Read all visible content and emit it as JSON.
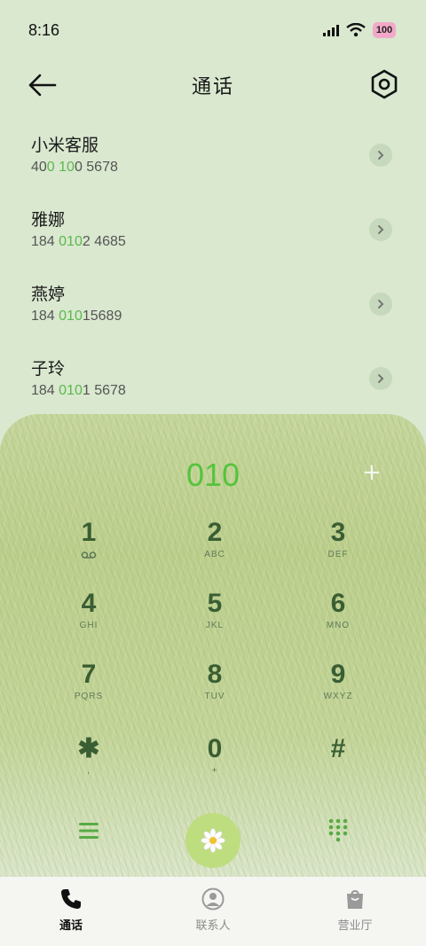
{
  "status_bar": {
    "time": "8:16",
    "battery": "100"
  },
  "header": {
    "title": "通话"
  },
  "contacts": [
    {
      "name": "小米客服",
      "number_parts": [
        "40",
        "0 10",
        "0 5678"
      ]
    },
    {
      "name": "雅娜",
      "number_parts": [
        "184 ",
        "010",
        "2 4685"
      ]
    },
    {
      "name": "燕婷",
      "number_parts": [
        "184 ",
        "010",
        "15689"
      ]
    },
    {
      "name": "子玲",
      "number_parts": [
        "184 ",
        "010",
        "1 5678"
      ]
    }
  ],
  "dialpad": {
    "dialed": "010",
    "add_symbol": "+",
    "keys": [
      {
        "digit": "1",
        "letters": ""
      },
      {
        "digit": "2",
        "letters": "ABC"
      },
      {
        "digit": "3",
        "letters": "DEF"
      },
      {
        "digit": "4",
        "letters": "GHI"
      },
      {
        "digit": "5",
        "letters": "JKL"
      },
      {
        "digit": "6",
        "letters": "MNO"
      },
      {
        "digit": "7",
        "letters": "PQRS"
      },
      {
        "digit": "8",
        "letters": "TUV"
      },
      {
        "digit": "9",
        "letters": "WXYZ"
      },
      {
        "digit": "✱",
        "letters": ","
      },
      {
        "digit": "0",
        "letters": "+"
      },
      {
        "digit": "#",
        "letters": ""
      }
    ]
  },
  "bottom_nav": {
    "tabs": [
      {
        "label": "通话",
        "icon": "phone-icon",
        "active": true
      },
      {
        "label": "联系人",
        "icon": "contacts-icon",
        "active": false
      },
      {
        "label": "营业厅",
        "icon": "shopping-bag-icon",
        "active": false
      }
    ]
  },
  "colors": {
    "accent": "#5cb84e",
    "dialed": "#56c33c",
    "key_text": "#3a5e33",
    "call_button": "#bedd7f"
  }
}
